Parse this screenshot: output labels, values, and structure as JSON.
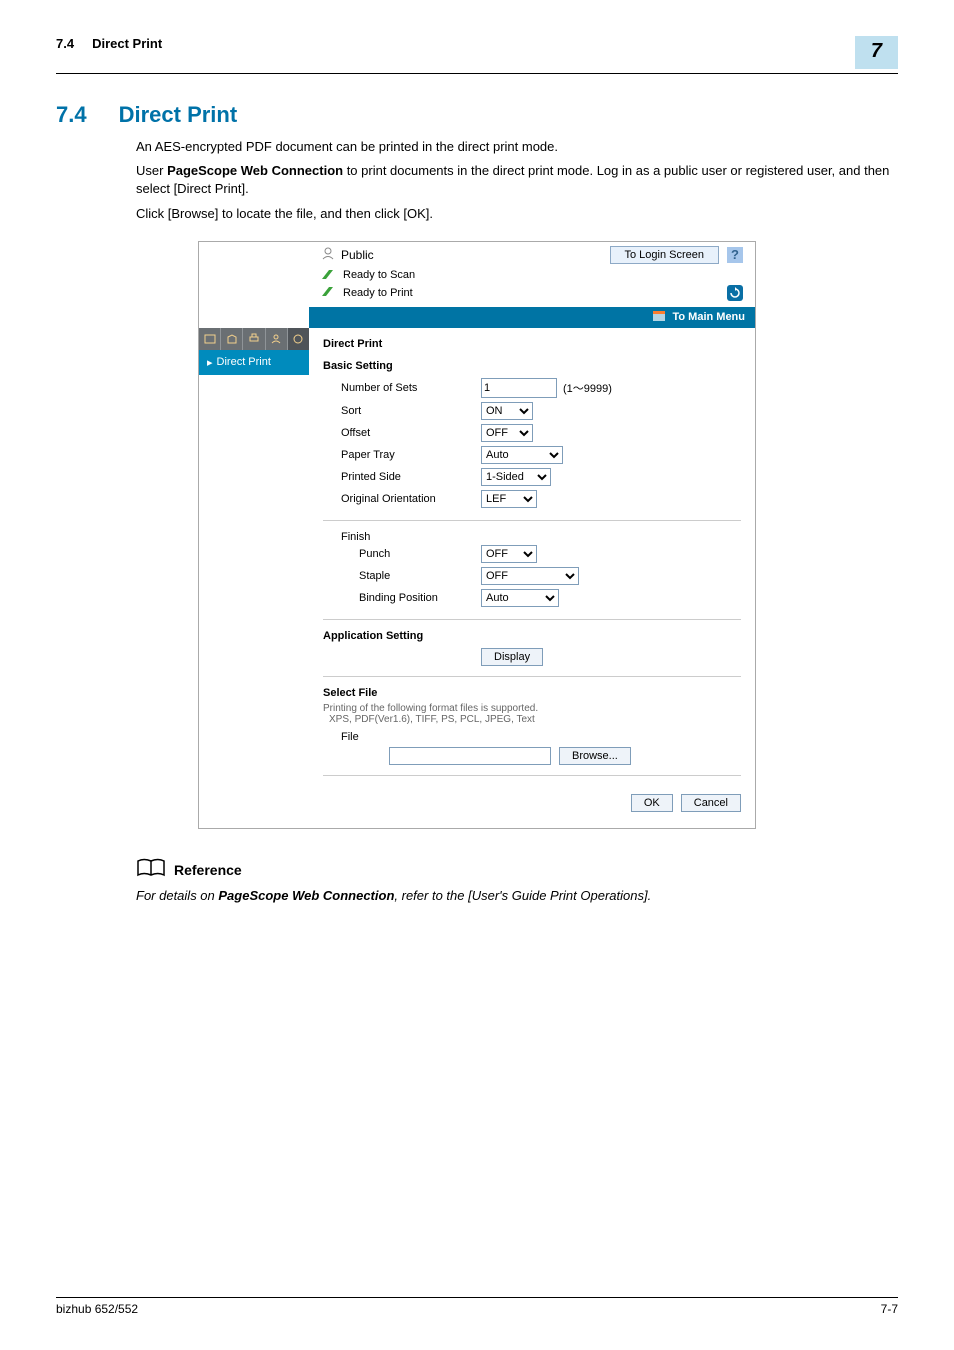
{
  "header": {
    "section_number": "7.4",
    "section_title": "Direct Print",
    "chapter_badge": "7"
  },
  "heading": {
    "number": "7.4",
    "title": "Direct Print"
  },
  "body": {
    "p1": "An AES-encrypted PDF document can be printed in the direct print mode.",
    "p2_a": "User ",
    "p2_strong": "PageScope Web Connection",
    "p2_b": " to print documents in the direct print mode. Log in as a public user or registered user, and then select [Direct Print].",
    "p3": "Click [Browse] to locate the file, and then click [OK]."
  },
  "uishot": {
    "user_label": "Public",
    "to_login_label": "To Login Screen",
    "help_label": "?",
    "status_scan": "Ready to Scan",
    "status_print": "Ready to Print",
    "to_main_menu": "To Main Menu",
    "sidebar_direct_print": "Direct Print",
    "content": {
      "title": "Direct Print",
      "basic_setting": "Basic Setting",
      "number_of_sets_label": "Number of Sets",
      "number_of_sets_value": "1",
      "number_of_sets_range": "(1～9999)",
      "sort_label": "Sort",
      "sort_value": "ON",
      "offset_label": "Offset",
      "offset_value": "OFF",
      "paper_tray_label": "Paper Tray",
      "paper_tray_value": "Auto",
      "printed_side_label": "Printed Side",
      "printed_side_value": "1-Sided",
      "orientation_label": "Original Orientation",
      "orientation_value": "LEF",
      "finish_label": "Finish",
      "punch_label": "Punch",
      "punch_value": "OFF",
      "staple_label": "Staple",
      "staple_value": "OFF",
      "binding_label": "Binding Position",
      "binding_value": "Auto",
      "app_setting_label": "Application Setting",
      "display_button": "Display",
      "select_file_label": "Select File",
      "supported_text": "Printing of the following format files is supported.",
      "supported_formats": "XPS, PDF(Ver1.6), TIFF, PS, PCL, JPEG, Text",
      "file_label": "File",
      "browse_button": "Browse...",
      "ok_button": "OK",
      "cancel_button": "Cancel"
    }
  },
  "reference": {
    "title": "Reference",
    "text_a": "For details on ",
    "text_strong": "PageScope Web Connection",
    "text_b": ", refer to the [User's Guide Print Operations]."
  },
  "footer": {
    "product": "bizhub 652/552",
    "page": "7-7"
  }
}
